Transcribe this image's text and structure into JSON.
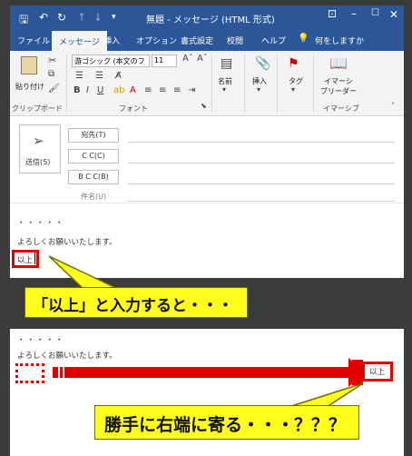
{
  "window": {
    "title": "無題 - メッセージ (HTML 形式)"
  },
  "quick_access": {
    "save_icon": "save-icon",
    "undo_icon": "undo-icon",
    "redo_icon": "redo-icon"
  },
  "tabs": [
    {
      "label": "ファイル"
    },
    {
      "label": "メッセージ"
    },
    {
      "label": "挿入"
    },
    {
      "label": "オプション"
    },
    {
      "label": "書式設定"
    },
    {
      "label": "校閲"
    },
    {
      "label": "ヘルプ"
    }
  ],
  "tell_me": "何をしますか",
  "ribbon": {
    "paste_label": "貼り付け",
    "clipboard_group": "クリップボード",
    "font_name": "游ゴシック (本文のフ",
    "font_size": "11",
    "font_group": "フォント",
    "names_label": "名前",
    "insert_label": "挿入",
    "tags_label": "タグ",
    "immersive_reader_label_1": "イマーシ",
    "immersive_reader_label_2": "ブリーダー",
    "immersive_group": "イマーシブ"
  },
  "compose": {
    "send_label": "送信(S)",
    "to_label": "宛先(T)",
    "cc_label": "C C(C)",
    "bcc_label": "B C C(B)",
    "subject_label": "件名(U)"
  },
  "body_top": {
    "dots": "・・・・・",
    "line": "よろしくお願いいたします。",
    "closing": "以上"
  },
  "callout_1": "「以上」と入力すると・・・",
  "body_bottom": {
    "dots": "・・・・・",
    "line": "よろしくお願いいたします。",
    "closing_right": "以上"
  },
  "callout_2": "勝手に右端に寄る・・・？？？",
  "colors": {
    "ribbon_blue": "#2b579a",
    "highlight_red": "#e00000",
    "callout_yellow": "#ffff1a"
  }
}
